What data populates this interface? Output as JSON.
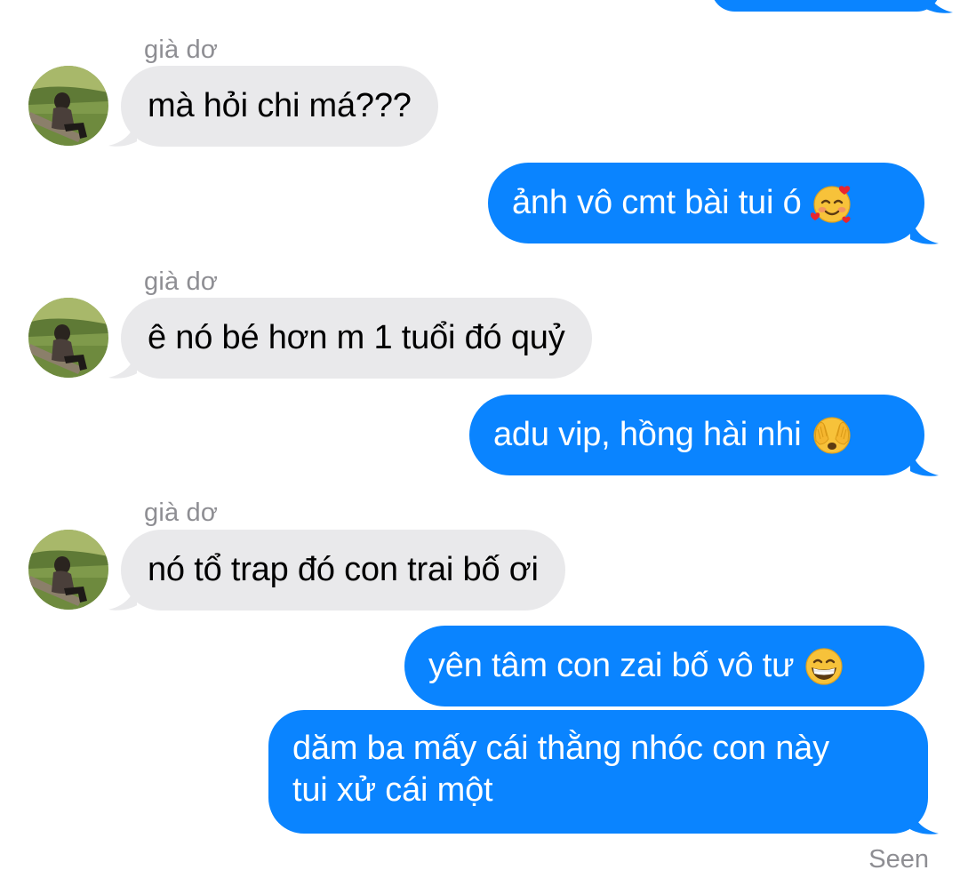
{
  "conversation": {
    "messages": [
      {
        "direction": "out",
        "text": ""
      },
      {
        "direction": "in",
        "sender": "già dơ",
        "text": "mà hỏi chi má???"
      },
      {
        "direction": "out",
        "text": "ảnh vô cmt bài tui ó",
        "emoji": "smiling-face-with-hearts"
      },
      {
        "direction": "in",
        "sender": "già dơ",
        "text": "ê nó bé hơn m 1 tuổi đó quỷ"
      },
      {
        "direction": "out",
        "text": "adu vip, hồng hài nhi",
        "emoji": "face-with-hands-over-eyes"
      },
      {
        "direction": "in",
        "sender": "già dơ",
        "text": "nó tổ trap đó con trai bố ơi"
      },
      {
        "direction": "out",
        "text": "yên tâm con zai bố vô tư",
        "emoji": "grinning-face"
      },
      {
        "direction": "out",
        "lines": [
          "dăm ba mấy cái thằng nhóc con này",
          "tui xử cái một"
        ]
      }
    ],
    "status": "Seen"
  },
  "colors": {
    "outgoing_bubble": "#0a84ff",
    "incoming_bubble": "#e9e9eb",
    "meta_text": "#8e8e93"
  }
}
